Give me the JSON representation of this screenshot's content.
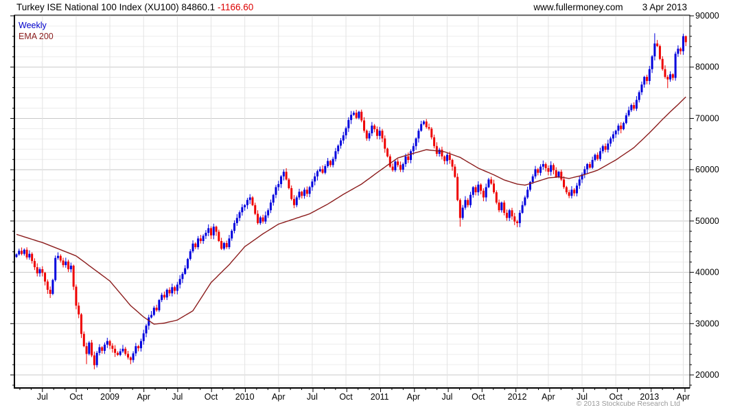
{
  "header": {
    "title": "Turkey ISE National 100 Index (XU100) 84860.1",
    "change": "-1166.60",
    "site": "www.fullermoney.com",
    "date": "3 Apr 2013"
  },
  "legend": {
    "timeframe": "Weekly",
    "overlay": "EMA 200"
  },
  "footer": {
    "copyright": "© 2013 Stockcube Research Ltd"
  },
  "colors": {
    "up_candle": "#0000dd",
    "down_candle": "#ee0000",
    "ema_line": "#8b1c1c",
    "change_text": "#dd0000",
    "legend_weekly": "#0000cc",
    "legend_ema": "#8b1c1c",
    "grid_minor": "#ececec",
    "grid_major": "#c8c8c8",
    "grid_vertical": "#e3e3e3",
    "axis_text": "#000000",
    "copyright_text": "#9a9a9a",
    "frame": "#000000"
  },
  "chart_data": {
    "type": "candlestick",
    "title": "Turkey ISE National 100 Index (XU100)",
    "subtitle": "Weekly candles with 200-week EMA, Apr 2008 - 3 Apr 2013",
    "last_close": 84860.1,
    "last_change": -1166.6,
    "ylim": [
      17500,
      90200
    ],
    "y_major_step": 10000,
    "y_minor_step": 2000,
    "y_ticks": [
      20000,
      30000,
      40000,
      50000,
      60000,
      70000,
      80000,
      90000
    ],
    "x_ticks": [
      {
        "week": 10,
        "label": "Jul"
      },
      {
        "week": 23,
        "label": "Oct"
      },
      {
        "week": 36,
        "label": "2009"
      },
      {
        "week": 49,
        "label": "Apr"
      },
      {
        "week": 62,
        "label": "Jul"
      },
      {
        "week": 75,
        "label": "Oct"
      },
      {
        "week": 88,
        "label": "2010"
      },
      {
        "week": 101,
        "label": "Apr"
      },
      {
        "week": 114,
        "label": "Jul"
      },
      {
        "week": 127,
        "label": "Oct"
      },
      {
        "week": 140,
        "label": "2011"
      },
      {
        "week": 153,
        "label": "Apr"
      },
      {
        "week": 166,
        "label": "Jul"
      },
      {
        "week": 178,
        "label": "Oct"
      },
      {
        "week": 193,
        "label": "2012"
      },
      {
        "week": 205,
        "label": "Apr"
      },
      {
        "week": 218,
        "label": "Jul"
      },
      {
        "week": 231,
        "label": "Oct"
      },
      {
        "week": 244,
        "label": "2013"
      },
      {
        "week": 257,
        "label": "Apr"
      }
    ],
    "first_open": 43000,
    "weekly_closes": [
      43500,
      44200,
      43600,
      44400,
      42900,
      43600,
      42200,
      41000,
      39800,
      40600,
      39900,
      38200,
      36600,
      35800,
      38500,
      42800,
      43200,
      42300,
      41400,
      42100,
      40600,
      41300,
      37200,
      33500,
      31800,
      28000,
      25600,
      24100,
      26300,
      23800,
      21900,
      24300,
      25400,
      24700,
      25900,
      26600,
      25700,
      25100,
      24300,
      23900,
      24600,
      25100,
      24100,
      23400,
      22900,
      24200,
      25600,
      25200,
      26600,
      28100,
      29600,
      31200,
      31700,
      33100,
      32600,
      34600,
      35600,
      35100,
      36600,
      35900,
      37100,
      36400,
      37600,
      38700,
      39700,
      40800,
      42600,
      44100,
      45600,
      44900,
      46600,
      46100,
      47100,
      47700,
      48600,
      47200,
      48900,
      47900,
      46100,
      44600,
      45700,
      44900,
      46600,
      48100,
      49600,
      50600,
      51700,
      52700,
      53100,
      54100,
      54600,
      53100,
      51400,
      49600,
      50700,
      49900,
      51100,
      52100,
      53600,
      55100,
      56600,
      57200,
      58700,
      59600,
      58100,
      56400,
      54300,
      53100,
      54600,
      55700,
      54900,
      56100,
      55300,
      56600,
      57700,
      58700,
      59700,
      60100,
      59400,
      60700,
      61700,
      60900,
      62100,
      63600,
      64700,
      65700,
      66700,
      68100,
      69700,
      70700,
      71100,
      70100,
      71300,
      69600,
      67600,
      66100,
      67100,
      68600,
      67900,
      66600,
      67600,
      66100,
      64100,
      62600,
      60600,
      59900,
      61600,
      60900,
      60000,
      61100,
      62600,
      61900,
      63600,
      64600,
      66100,
      67600,
      68900,
      69400,
      68300,
      68000,
      66300,
      64600,
      63100,
      63900,
      62600,
      61700,
      62900,
      61900,
      60600,
      58600,
      54100,
      50600,
      52600,
      54100,
      53100,
      55100,
      56600,
      55600,
      57100,
      55900,
      54600,
      56600,
      58100,
      57300,
      55600,
      53600,
      52100,
      53600,
      51600,
      50600,
      52100,
      50900,
      49900,
      49600,
      51600,
      53100,
      54600,
      56100,
      57600,
      58700,
      60100,
      59400,
      60600,
      61100,
      60300,
      59600,
      60900,
      59900,
      58600,
      59600,
      58100,
      56600,
      55600,
      54900,
      56100,
      55400,
      56900,
      58100,
      59100,
      60100,
      61100,
      60400,
      61900,
      62900,
      62100,
      63600,
      64600,
      63900,
      65100,
      66100,
      66900,
      67600,
      68600,
      67900,
      69100,
      70600,
      71600,
      72600,
      71900,
      73600,
      75100,
      76600,
      78100,
      77300,
      79600,
      82100,
      84600,
      84100,
      81600,
      79600,
      78100,
      77600,
      78600,
      77900,
      82600,
      83600,
      83100,
      86026.7,
      84860.1
    ],
    "wick_overrides": {
      "13": {
        "lo": 35000
      },
      "27": {
        "lo": 22100
      },
      "30": {
        "lo": 21100
      },
      "44": {
        "lo": 22100
      },
      "107": {
        "lo": 52500
      },
      "171": {
        "lo": 48900
      },
      "193": {
        "lo": 48800
      },
      "246": {
        "hi": 86600
      },
      "251": {
        "lo": 75900
      },
      "258": {
        "hi": 86150
      }
    },
    "ema200_keypoints": [
      [
        0,
        47400
      ],
      [
        10,
        45800
      ],
      [
        23,
        43200
      ],
      [
        36,
        38300
      ],
      [
        44,
        33500
      ],
      [
        49,
        31300
      ],
      [
        53,
        29900
      ],
      [
        57,
        30100
      ],
      [
        62,
        30700
      ],
      [
        68,
        32500
      ],
      [
        75,
        38000
      ],
      [
        82,
        41500
      ],
      [
        88,
        45000
      ],
      [
        95,
        47500
      ],
      [
        101,
        49400
      ],
      [
        107,
        50400
      ],
      [
        113,
        51400
      ],
      [
        120,
        53300
      ],
      [
        126,
        55200
      ],
      [
        133,
        57200
      ],
      [
        140,
        59800
      ],
      [
        147,
        62300
      ],
      [
        153,
        63200
      ],
      [
        158,
        63900
      ],
      [
        165,
        63500
      ],
      [
        171,
        62400
      ],
      [
        178,
        60300
      ],
      [
        184,
        59000
      ],
      [
        188,
        58000
      ],
      [
        193,
        57200
      ],
      [
        196,
        57000
      ],
      [
        200,
        57600
      ],
      [
        205,
        58400
      ],
      [
        209,
        58600
      ],
      [
        213,
        58300
      ],
      [
        218,
        58900
      ],
      [
        224,
        59900
      ],
      [
        231,
        61900
      ],
      [
        238,
        64300
      ],
      [
        244,
        67200
      ],
      [
        249,
        69800
      ],
      [
        252,
        71300
      ],
      [
        255,
        72700
      ],
      [
        258,
        74200
      ]
    ]
  }
}
